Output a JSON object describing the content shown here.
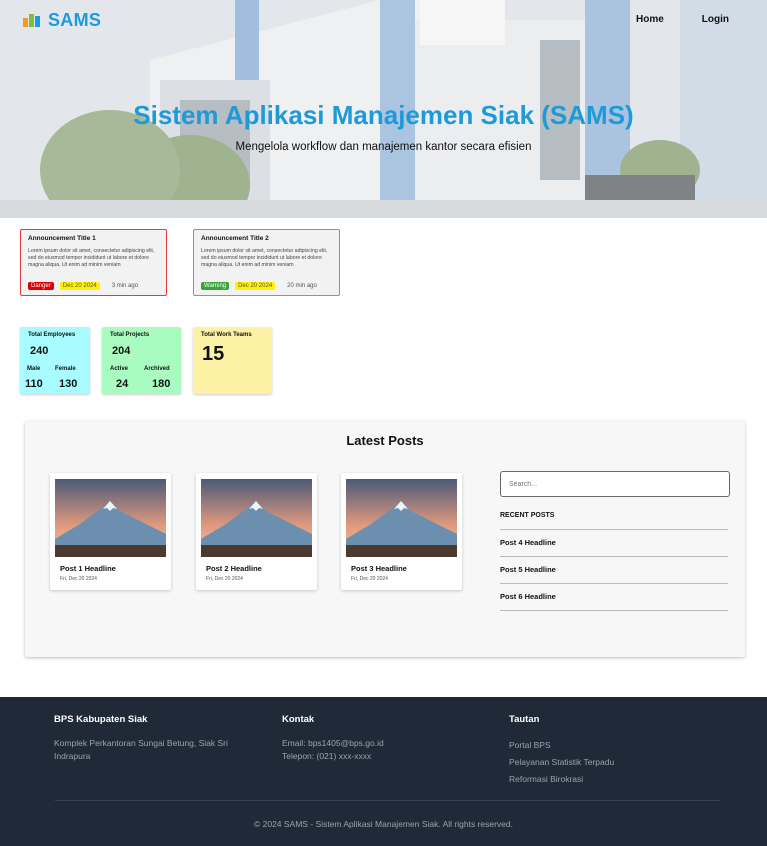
{
  "nav": {
    "brand": "SAMS",
    "links": [
      "Home",
      "Login"
    ]
  },
  "hero": {
    "title": "Sistem Aplikasi Manajemen Siak (SAMS)",
    "subtitle": "Mengelola workflow dan manajemen kantor secara efisien"
  },
  "announcements": [
    {
      "title": "Announcement Title 1",
      "body": "Lorem ipsum dolor sit amet, consectetur adipiscing elit, sed do eiusmod tempor incididunt ut labore et dolore magna aliqua. Ut enim ad minim veniam",
      "level": "Danger",
      "date": "Dec 20 2024",
      "ago": "3 min ago",
      "border_color": "#e23b3b",
      "level_color": "#e00000"
    },
    {
      "title": "Announcement Title 2",
      "body": "Lorem ipsum dolor sit amet, consectetur adipiscing elit, sed do eiusmod tempor incididunt ut labore et dolore magna aliqua. Ut enim ad minim veniam",
      "level": "Warning",
      "date": "Dec 20 2024",
      "ago": "20 min ago",
      "border_color": "#5cb85c",
      "level_color": "#3aa53a"
    }
  ],
  "stats": {
    "employees": {
      "label": "Total Employees",
      "total": "240",
      "male_label": "Male",
      "female_label": "Female",
      "male": "110",
      "female": "130",
      "color": "#a8fbff"
    },
    "projects": {
      "label": "Total Projects",
      "total": "204",
      "active_label": "Active",
      "archived_label": "Archived",
      "active": "24",
      "archived": "180",
      "color": "#a8fcc0"
    },
    "teams": {
      "label": "Total Work Teams",
      "total": "15",
      "color": "#fdf1a6"
    }
  },
  "posts": {
    "heading": "Latest Posts",
    "items": [
      {
        "headline": "Post 1 Headline",
        "date": "Fri, Dec 20 2024"
      },
      {
        "headline": "Post 2 Headline",
        "date": "Fri, Dec 20 2024"
      },
      {
        "headline": "Post 3 Headline",
        "date": "Fri, Dec 20 2024"
      }
    ],
    "search_placeholder": "Search...",
    "recent_title": "RECENT POSTS",
    "recent": [
      "Post 4 Headline",
      "Post 5 Headline",
      "Post 6 Headline"
    ]
  },
  "footer": {
    "col1_title": "BPS Kabupaten Siak",
    "col1_text": "Komplek Perkantoran Sungai Betung, Siak Sri Indrapura",
    "col2_title": "Kontak",
    "email": "Email: bps1405@bps.go.id",
    "phone": "Telepon: (021) xxx-xxxx",
    "col3_title": "Tautan",
    "links": [
      "Portal BPS",
      "Pelayanan Statistik Terpadu",
      "Reformasi Birokrasi"
    ],
    "copyright": "© 2024 SAMS - Sistem Aplikasi Manajemen Siak. All rights reserved."
  }
}
